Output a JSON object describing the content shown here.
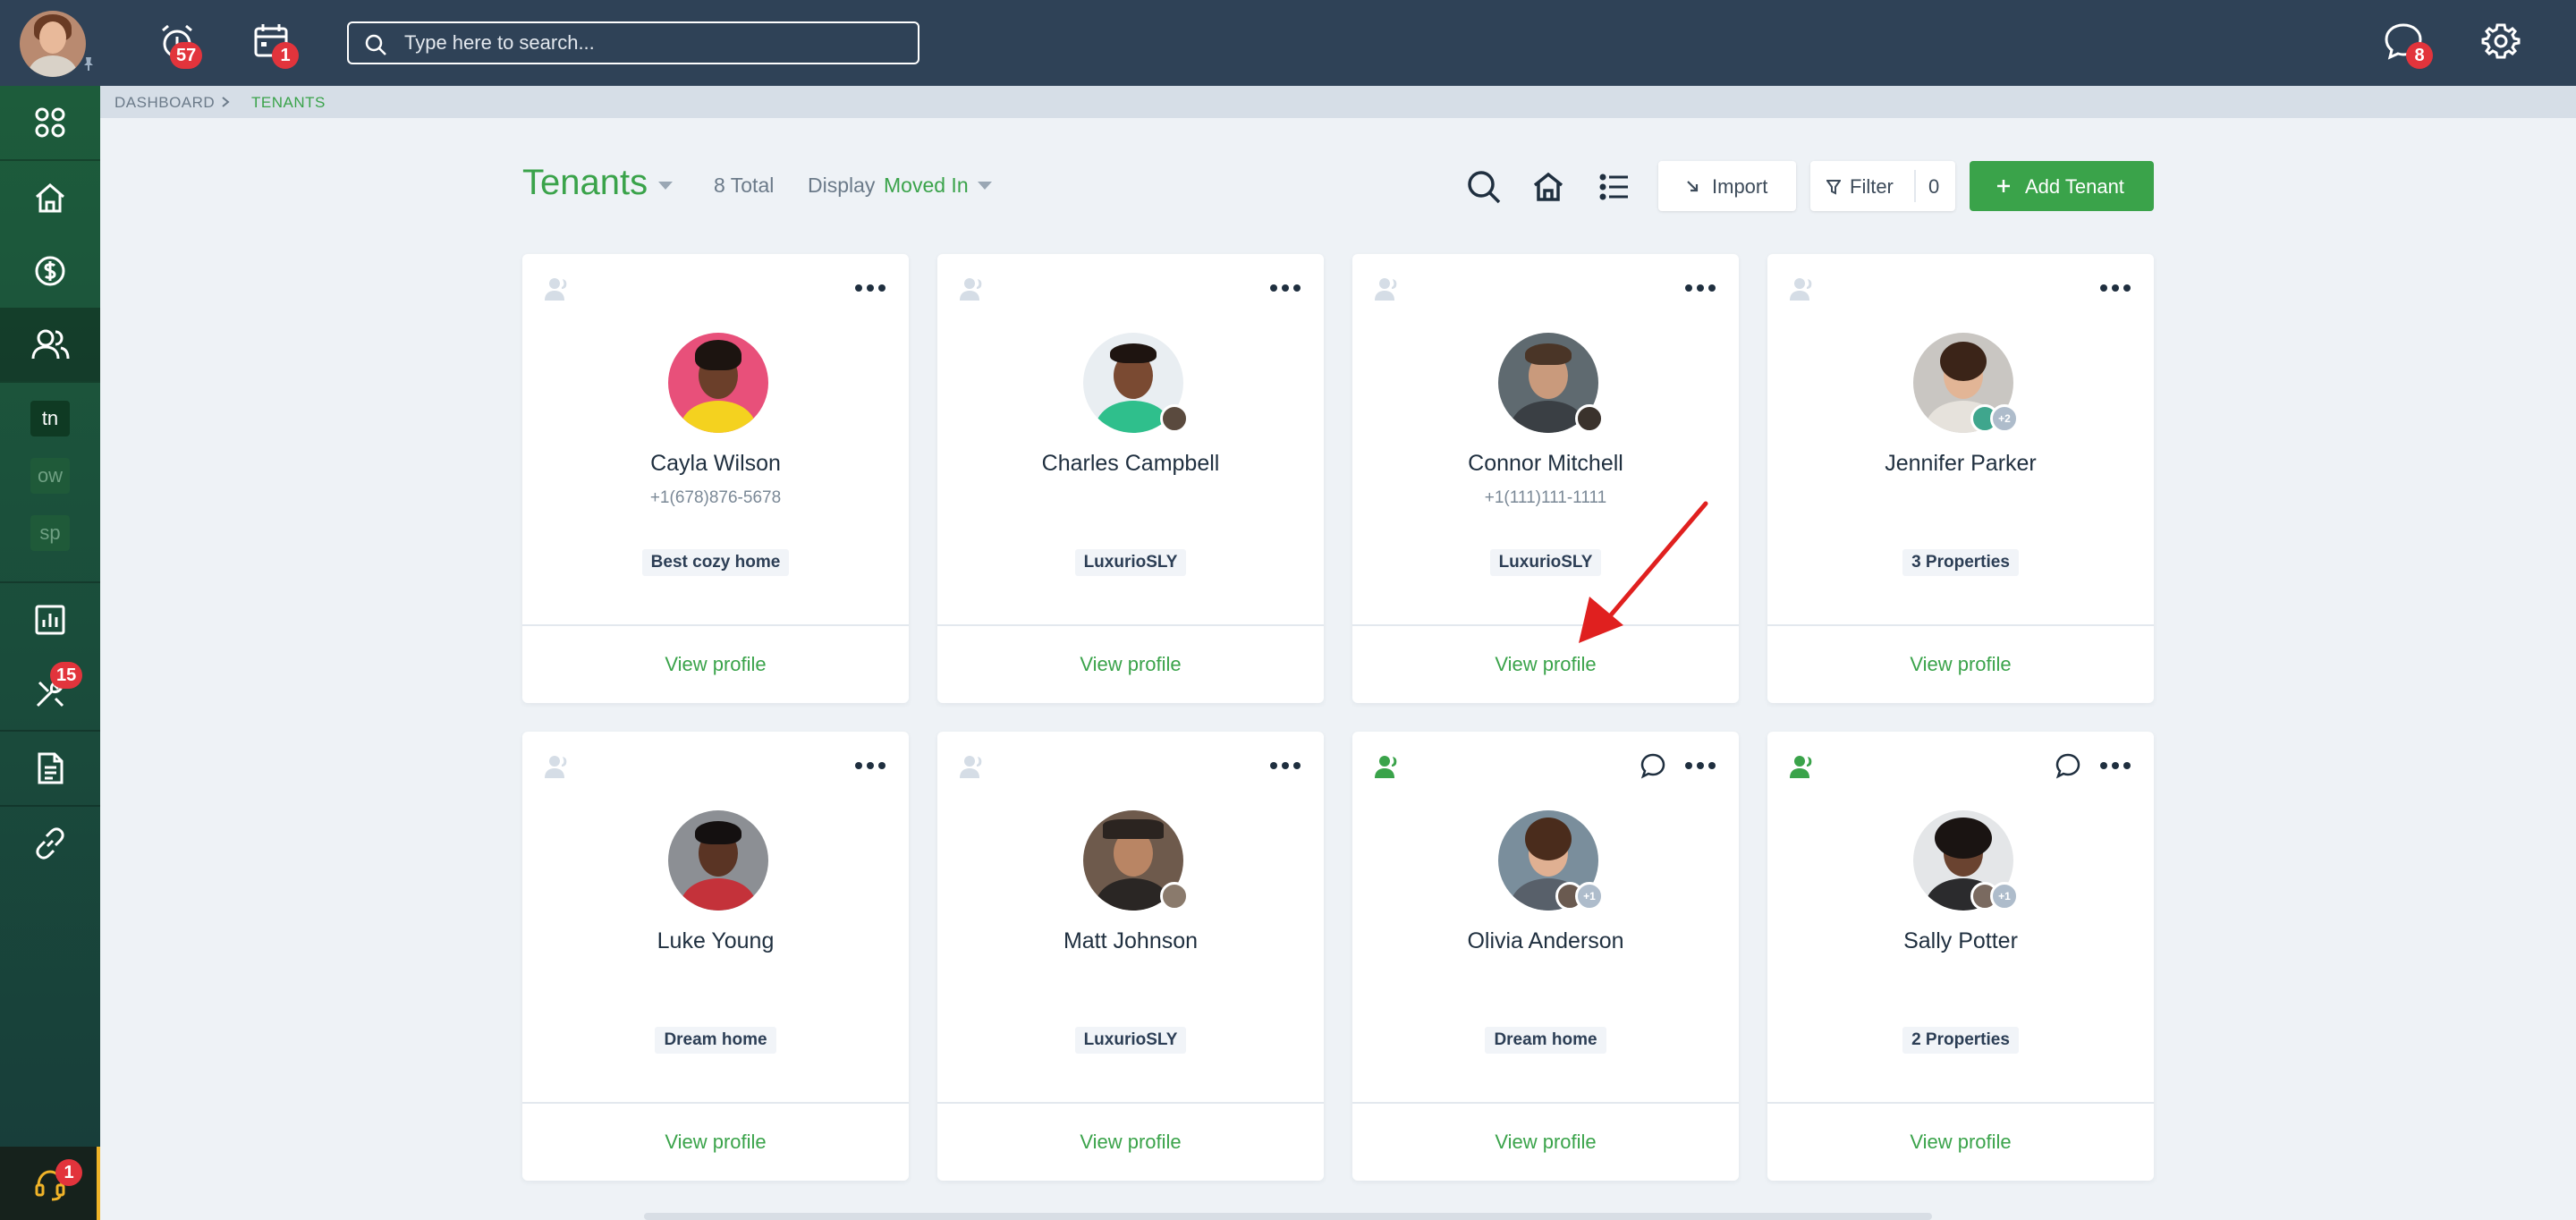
{
  "topbar": {
    "search_placeholder": "Type here to search...",
    "notifications_count": "57",
    "calendar_count": "1",
    "messages_count": "8"
  },
  "sidebar": {
    "chips": [
      "tn",
      "ow",
      "sp"
    ],
    "maintenance_count": "15",
    "support_count": "1"
  },
  "breadcrumb": {
    "dashboard": "DASHBOARD",
    "current": "TENANTS"
  },
  "header": {
    "title": "Tenants",
    "total": "8 Total",
    "display_label": "Display",
    "display_value": "Moved In",
    "import_label": "Import",
    "filter_label": "Filter",
    "filter_count": "0",
    "add_label": "Add Tenant"
  },
  "colors": {
    "accent": "#3aa34a",
    "topbar": "#2f4257",
    "badge": "#e2343c",
    "annotation": "#e0201f"
  },
  "tenants": [
    {
      "name": "Cayla Wilson",
      "phone": "+1(678)876-5678",
      "tag": "Best cozy home",
      "action": "View profile",
      "extra": ""
    },
    {
      "name": "Charles Campbell",
      "phone": "",
      "tag": "LuxurioSLY",
      "action": "View profile",
      "extra": ""
    },
    {
      "name": "Connor Mitchell",
      "phone": "+1(111)111-1111",
      "tag": "LuxurioSLY",
      "action": "View profile",
      "extra": ""
    },
    {
      "name": "Jennifer Parker",
      "phone": "",
      "tag": "3 Properties",
      "action": "View profile",
      "extra": "+2"
    },
    {
      "name": "Luke Young",
      "phone": "",
      "tag": "Dream home",
      "action": "View profile",
      "extra": ""
    },
    {
      "name": "Matt Johnson",
      "phone": "",
      "tag": "LuxurioSLY",
      "action": "View profile",
      "extra": ""
    },
    {
      "name": "Olivia Anderson",
      "phone": "",
      "tag": "Dream home",
      "action": "View profile",
      "extra": "+1"
    },
    {
      "name": "Sally Potter",
      "phone": "",
      "tag": "2 Properties",
      "action": "View profile",
      "extra": "+1"
    }
  ]
}
